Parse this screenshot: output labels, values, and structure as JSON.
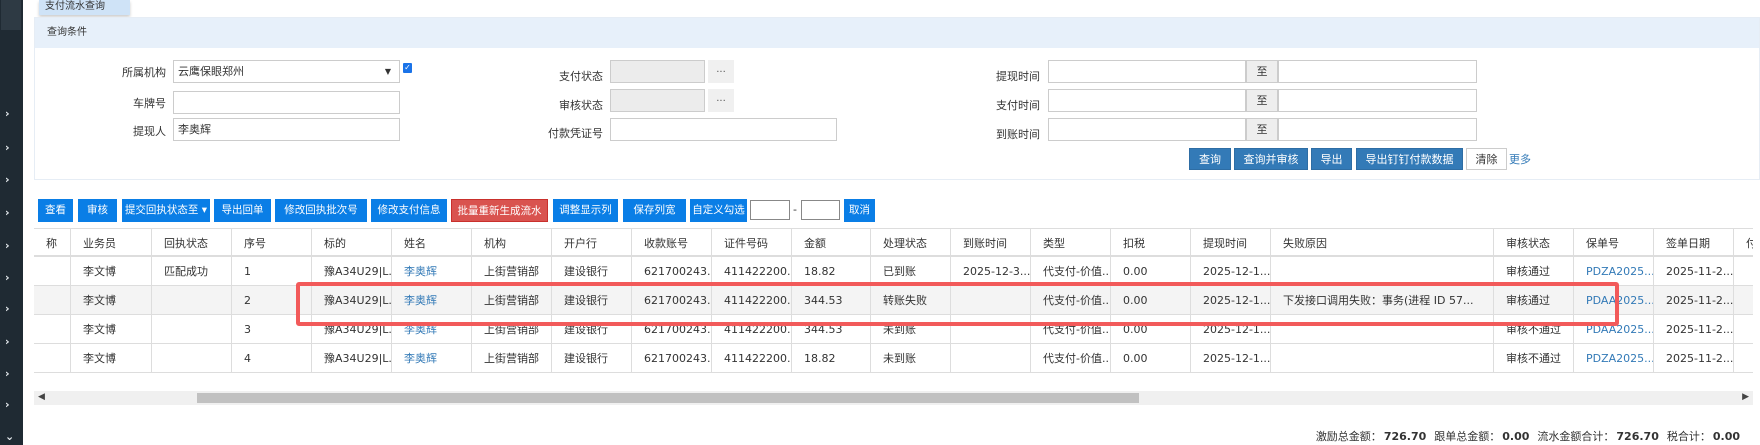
{
  "tab": {
    "label": "支付流水查询"
  },
  "query": {
    "title": "查询条件",
    "org_label": "所属机构",
    "org_value": "云鹰保眼郑州",
    "plate_label": "车牌号",
    "plate_value": "",
    "withdrawer_label": "提现人",
    "withdrawer_value": "李奥辉",
    "pay_status_label": "支付状态",
    "audit_status_label": "审核状态",
    "voucher_label": "付款凭证号",
    "dots": "...",
    "withdraw_time_label": "提现时间",
    "pay_time_label": "支付时间",
    "arrive_time_label": "到账时间",
    "to": "至",
    "buttons": {
      "search": "查询",
      "search_audit": "查询并审核",
      "export": "导出",
      "export_dingtalk": "导出钉钉付款数据",
      "clear": "清除",
      "more": "更多"
    }
  },
  "toolbar": {
    "view": "查看",
    "audit": "审核",
    "submit_status": "提交回执状态至 ▾",
    "export_receipt": "导出回单",
    "edit_batch": "修改回执批次号",
    "edit_pay": "修改支付信息",
    "regen": "批量重新生成流水",
    "adjust_cols": "调整显示列",
    "save_width": "保存列宽",
    "custom_select": "自定义勾选",
    "dash": "-",
    "cancel": "取消"
  },
  "table": {
    "columns": [
      "称",
      "业务员",
      "回执状态",
      "序号",
      "标的",
      "姓名",
      "机构",
      "开户行",
      "收款账号",
      "证件号码",
      "金额",
      "处理状态",
      "到账时间",
      "类型",
      "扣税",
      "提现时间",
      "失败原因",
      "审核状态",
      "保单号",
      "签单日期",
      "付"
    ],
    "rows": [
      [
        "",
        "李文博",
        "匹配成功",
        "1",
        "豫A34U29|L...",
        "李奥辉",
        "上街营销部",
        "建设银行",
        "621700243...",
        "411422200...",
        "18.82",
        "已到账",
        "2025-12-3...",
        "代支付-价值...",
        "0.00",
        "2025-12-1...",
        "",
        "审核通过",
        "PDZA2025...",
        "2025-11-2...",
        ""
      ],
      [
        "",
        "李文博",
        "",
        "2",
        "豫A34U29|L...",
        "李奥辉",
        "上街营销部",
        "建设银行",
        "621700243...",
        "411422200...",
        "344.53",
        "转账失败",
        "",
        "代支付-价值...",
        "0.00",
        "2025-12-1...",
        "下发接口调用失败：事务(进程 ID 57...",
        "审核通过",
        "PDAA2025...",
        "2025-11-2...",
        ""
      ],
      [
        "",
        "李文博",
        "",
        "3",
        "豫A34U29|L...",
        "李奥辉",
        "上街营销部",
        "建设银行",
        "621700243...",
        "411422200...",
        "344.53",
        "未到账",
        "",
        "代支付-价值...",
        "0.00",
        "2025-12-1...",
        "",
        "审核不通过",
        "PDAA2025...",
        "2025-11-2...",
        ""
      ],
      [
        "",
        "李文博",
        "",
        "4",
        "豫A34U29|L...",
        "李奥辉",
        "上街营销部",
        "建设银行",
        "621700243...",
        "411422200...",
        "18.82",
        "未到账",
        "",
        "代支付-价值...",
        "0.00",
        "2025-12-1...",
        "",
        "审核不通过",
        "PDZA2025...",
        "2025-11-2...",
        ""
      ]
    ]
  },
  "summary": {
    "incentive_label": "激励总金额：",
    "incentive": "726.70",
    "follow_label": "跟单总金额：",
    "follow": "0.00",
    "flow_label": "流水金额合计：",
    "flow": "726.70",
    "tax_label": "税合计：",
    "tax": "0.00"
  }
}
